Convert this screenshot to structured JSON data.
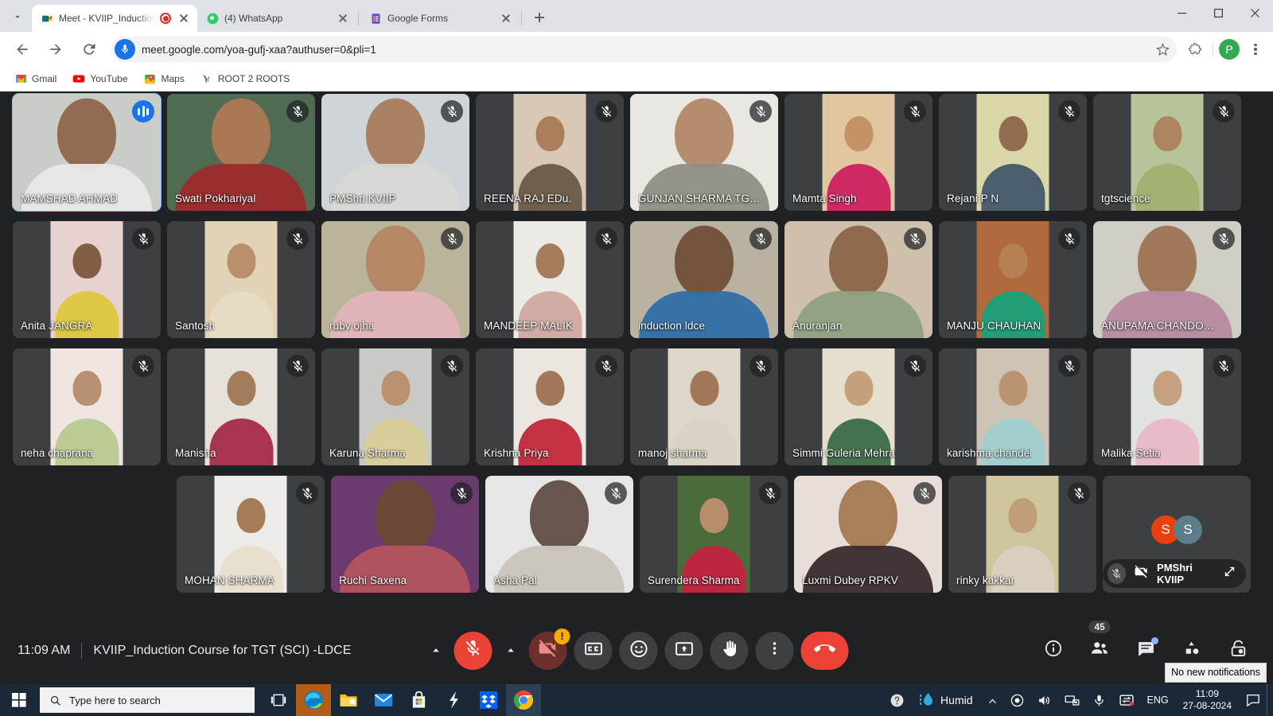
{
  "browser": {
    "tabs": [
      {
        "title": "Meet - KVIIP_Induction Cou",
        "favicon": "google-meet-icon",
        "recording": true,
        "active": true
      },
      {
        "title": "(4) WhatsApp",
        "favicon": "whatsapp-icon",
        "recording": false,
        "active": false
      },
      {
        "title": "Google Forms",
        "favicon": "google-forms-icon",
        "recording": false,
        "active": false
      }
    ],
    "url": "meet.google.com/yoa-gufj-xaa?authuser=0&pli=1",
    "omnibox_icon": "microphone-icon",
    "profile_initial": "P",
    "bookmarks": [
      {
        "label": "Gmail",
        "icon": "gmail-icon"
      },
      {
        "label": "YouTube",
        "icon": "youtube-icon"
      },
      {
        "label": "Maps",
        "icon": "google-maps-icon"
      },
      {
        "label": "ROOT 2 ROOTS",
        "icon": "root2roots-icon"
      }
    ]
  },
  "meet": {
    "time": "11:09 AM",
    "meeting_title": "KVIIP_Induction Course for TGT (SCI) -LDCE",
    "participant_count": "45",
    "self_view": {
      "name": "PMShri KVIIP",
      "avatar_initials": [
        "S",
        "S"
      ],
      "avatar_colors": [
        "#e8400f",
        "#5c7d8a"
      ],
      "muted": true,
      "camera_off": true
    },
    "controls": {
      "mic": {
        "label": "Turn on microphone",
        "state": "muted"
      },
      "camera": {
        "label": "Turn on camera",
        "state": "off",
        "warning": "!"
      },
      "captions": {
        "label": "Turn on captions"
      },
      "reactions": {
        "label": "Send a reaction"
      },
      "present": {
        "label": "Present now"
      },
      "raise_hand": {
        "label": "Raise hand"
      },
      "more": {
        "label": "More options"
      },
      "leave": {
        "label": "Leave call"
      }
    },
    "right_controls": [
      {
        "name": "meeting-details",
        "icon": "info-icon",
        "badge": null,
        "dot": false
      },
      {
        "name": "show-everyone",
        "icon": "people-icon",
        "badge": "45",
        "dot": false
      },
      {
        "name": "chat-with-everyone",
        "icon": "chat-icon",
        "badge": null,
        "dot": true
      },
      {
        "name": "activities",
        "icon": "activities-icon",
        "badge": null,
        "dot": false
      },
      {
        "name": "host-controls",
        "icon": "lock-icon",
        "badge": null,
        "dot": false
      }
    ],
    "rows": [
      [
        {
          "name": "MAMSHAD AHMAD",
          "muted": false,
          "speaking": true,
          "bg": "#c9cdc7",
          "fill": true,
          "skin": "#8d6348",
          "cloth": "#e8e8e6"
        },
        {
          "name": "Swati Pokhariyal",
          "muted": true,
          "speaking": false,
          "bg": "#4f6b52",
          "fill": true,
          "skin": "#b07a55",
          "cloth": "#9c2b2b"
        },
        {
          "name": "PMShri KVIIP",
          "muted": true,
          "speaking": false,
          "bg": "#cfd4d8",
          "fill": true,
          "skin": "#a8795a",
          "cloth": "#d8d8d4"
        },
        {
          "name": "REENA RAJ EDu.",
          "muted": true,
          "speaking": false,
          "bg": "#d8c9b6",
          "fill": false,
          "skin": "#a67852",
          "cloth": "#6b5a48"
        },
        {
          "name": "GUNJAN SHARMA TG…",
          "muted": true,
          "speaking": false,
          "bg": "#e9e7e2",
          "fill": true,
          "skin": "#b08463",
          "cloth": "#8f8f86"
        },
        {
          "name": "Mamta Singh",
          "muted": true,
          "speaking": false,
          "bg": "#e0c79f",
          "fill": false,
          "skin": "#c08d62",
          "cloth": "#cf2060"
        },
        {
          "name": "Rejani P N",
          "muted": true,
          "speaking": false,
          "bg": "#d9d7a8",
          "fill": false,
          "skin": "#8a6446",
          "cloth": "#43596b"
        },
        {
          "name": "tgtscience",
          "muted": true,
          "speaking": false,
          "bg": "#b7c49a",
          "fill": false,
          "skin": "#ad7e5c",
          "cloth": "#9fb06f"
        }
      ],
      [
        {
          "name": "Anita JANGRA",
          "muted": true,
          "speaking": false,
          "bg": "#e7d2cf",
          "fill": false,
          "skin": "#7a5438",
          "cloth": "#dcc63c"
        },
        {
          "name": "Santosh",
          "muted": true,
          "speaking": false,
          "bg": "#e3d3b6",
          "fill": false,
          "skin": "#b58a66",
          "cloth": "#e5dcc4"
        },
        {
          "name": "ruby ojha",
          "muted": true,
          "speaking": false,
          "bg": "#b9b49a",
          "fill": true,
          "skin": "#b5835f",
          "cloth": "#e1b4bb"
        },
        {
          "name": "MANDEEP MALIK",
          "muted": true,
          "speaking": false,
          "bg": "#eceae4",
          "fill": false,
          "skin": "#9d7350",
          "cloth": "#cfa9a0"
        },
        {
          "name": "induction ldce",
          "muted": true,
          "speaking": false,
          "bg": "#b9b2a3",
          "fill": true,
          "skin": "#6e4c33",
          "cloth": "#2f6fa8"
        },
        {
          "name": "Anuranjan",
          "muted": true,
          "speaking": false,
          "bg": "#cfc0ab",
          "fill": true,
          "skin": "#8a6344",
          "cloth": "#8fa07f"
        },
        {
          "name": "MANJU CHAUHAN",
          "muted": true,
          "speaking": false,
          "bg": "#b06a3c",
          "fill": false,
          "skin": "#b58257",
          "cloth": "#1aa07a"
        },
        {
          "name": "ANUPAMA CHANDO…",
          "muted": true,
          "speaking": false,
          "bg": "#cfcdc4",
          "fill": true,
          "skin": "#9d7250",
          "cloth": "#b78aa0"
        }
      ],
      [
        {
          "name": "neha chaprana",
          "muted": true,
          "speaking": false,
          "bg": "#efe6e1",
          "fill": false,
          "skin": "#b28a68",
          "cloth": "#b8c98f"
        },
        {
          "name": "Manisha",
          "muted": true,
          "speaking": false,
          "bg": "#e6e2db",
          "fill": false,
          "skin": "#9c7350",
          "cloth": "#a52a4a"
        },
        {
          "name": "Karuna Sharma",
          "muted": true,
          "speaking": false,
          "bg": "#c9c9c7",
          "fill": false,
          "skin": "#b98d67",
          "cloth": "#d8cf9a"
        },
        {
          "name": "Krishna Priya",
          "muted": true,
          "speaking": false,
          "bg": "#ece6e0",
          "fill": false,
          "skin": "#9a6f4f",
          "cloth": "#c0283a"
        },
        {
          "name": "manoj sharma",
          "muted": true,
          "speaking": false,
          "bg": "#dcd6cb",
          "fill": false,
          "skin": "#9b7150",
          "cloth": "#d8d3c5"
        },
        {
          "name": "Simmi Guleria Mehra",
          "muted": true,
          "speaking": false,
          "bg": "#e4dfcf",
          "fill": false,
          "skin": "#c29a75",
          "cloth": "#3b6b47"
        },
        {
          "name": "karishma chandel",
          "muted": true,
          "speaking": false,
          "bg": "#cfc3b6",
          "fill": false,
          "skin": "#b8906c",
          "cloth": "#9fd0cf"
        },
        {
          "name": "Malika Setia",
          "muted": true,
          "speaking": false,
          "bg": "#dfe4e0",
          "fill": false,
          "skin": "#c49a78",
          "cloth": "#e8b8c4"
        }
      ],
      [
        {
          "name": "MOHAN SHARMA",
          "muted": true,
          "speaking": false,
          "bg": "#ecebe7",
          "fill": false,
          "skin": "#a0714c",
          "cloth": "#e7dfcd"
        },
        {
          "name": "Ruchi Saxena",
          "muted": true,
          "speaking": false,
          "bg": "#6b3a6e",
          "fill": true,
          "skin": "#6d4a31",
          "cloth": "#b5545e"
        },
        {
          "name": "Asha Pal",
          "muted": true,
          "speaking": false,
          "bg": "#e6e6e6",
          "fill": true,
          "skin": "#5b4a40",
          "cloth": "#c9c5bd"
        },
        {
          "name": "Surendera Sharma",
          "muted": true,
          "speaking": false,
          "bg": "#4c6b3a",
          "fill": false,
          "skin": "#c09070",
          "cloth": "#c2243f"
        },
        {
          "name": "Luxmi Dubey RPKV",
          "muted": true,
          "speaking": false,
          "bg": "#e9ddd8",
          "fill": true,
          "skin": "#a3764f",
          "cloth": "#3a2a2e"
        },
        {
          "name": "rinky kakkar",
          "muted": true,
          "speaking": false,
          "bg": "#cfc59d",
          "fill": false,
          "skin": "#c09a77",
          "cloth": "#d8d0c2"
        }
      ]
    ]
  },
  "taskbar": {
    "search_placeholder": "Type here to search",
    "apps": [
      {
        "name": "task-view-icon"
      },
      {
        "name": "microsoft-edge-icon"
      },
      {
        "name": "file-explorer-icon"
      },
      {
        "name": "mail-icon"
      },
      {
        "name": "microsoft-store-icon"
      },
      {
        "name": "shareit-icon"
      },
      {
        "name": "dropbox-icon"
      },
      {
        "name": "google-chrome-icon"
      }
    ],
    "weather": "Humid",
    "language": "ENG",
    "time": "11:09",
    "date": "27-08-2024",
    "notification_tooltip": "No new notifications"
  }
}
